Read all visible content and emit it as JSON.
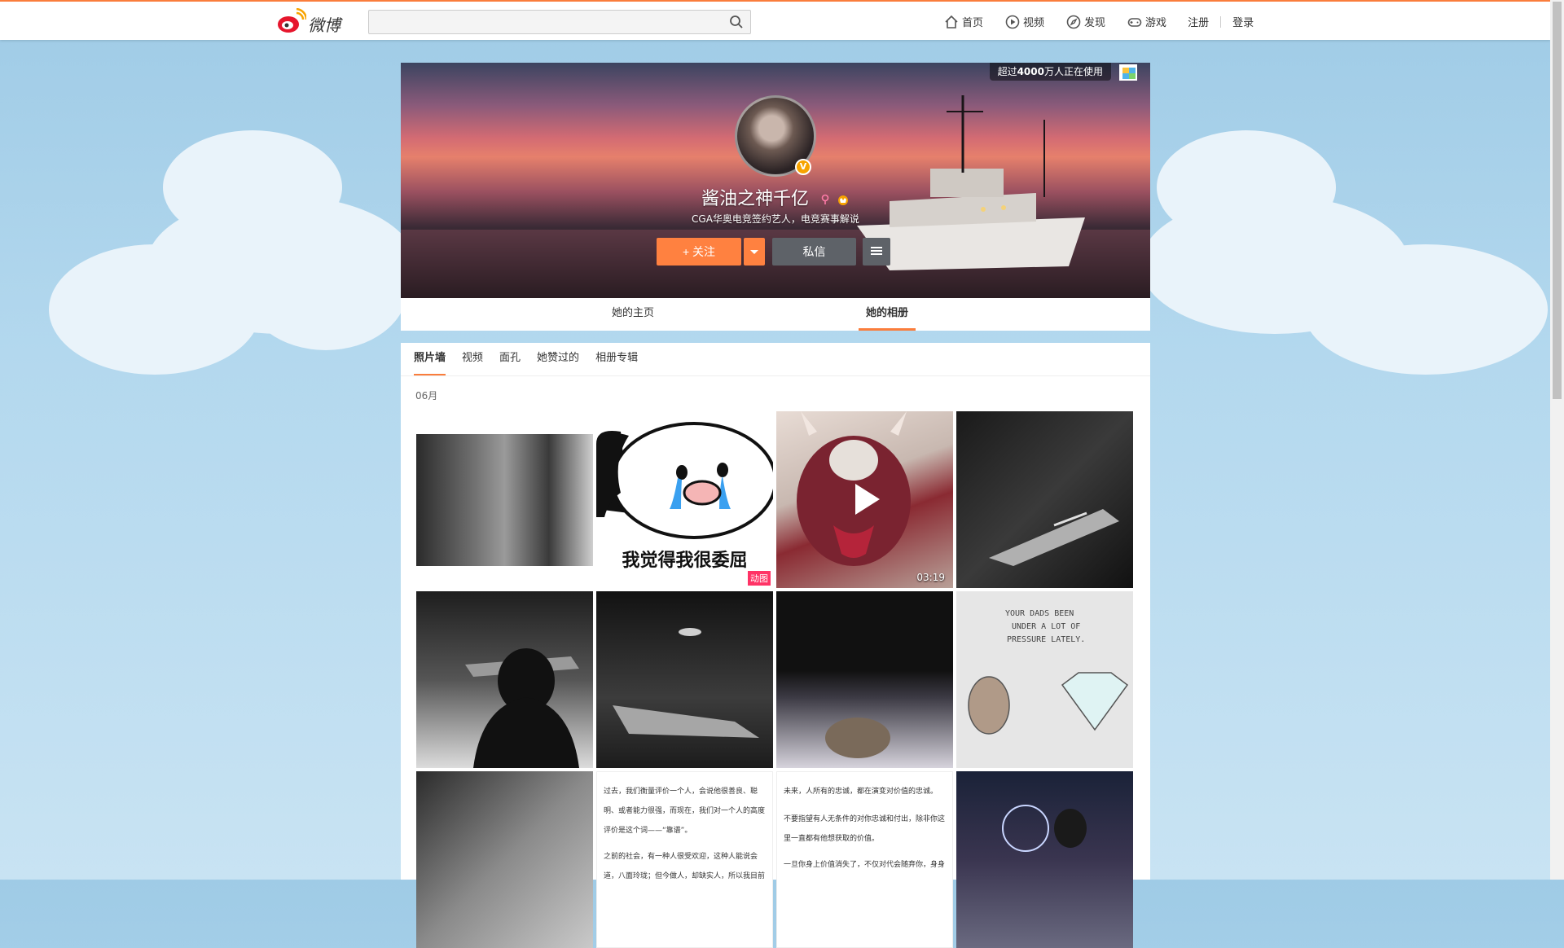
{
  "topbar": {
    "logo_text": "微博",
    "search_placeholder": "",
    "nav": [
      {
        "label": "首页",
        "icon": "home-icon"
      },
      {
        "label": "视频",
        "icon": "video-icon"
      },
      {
        "label": "发现",
        "icon": "discover-icon"
      },
      {
        "label": "游戏",
        "icon": "game-icon"
      }
    ],
    "register": "注册",
    "login": "登录"
  },
  "banner": {
    "using_prefix": "超过",
    "using_count": "4000",
    "using_suffix": "万人正在使用",
    "name": "酱油之神千亿",
    "desc": "CGA华奥电竞签约艺人，电竞赛事解说",
    "follow_label": "+ 关注",
    "message_label": "私信"
  },
  "profile_tabs": [
    {
      "label": "她的主页",
      "active": false
    },
    {
      "label": "她的相册",
      "active": true
    }
  ],
  "album": {
    "sub_tabs": [
      {
        "label": "照片墙",
        "active": true
      },
      {
        "label": "视频",
        "active": false
      },
      {
        "label": "面孔",
        "active": false
      },
      {
        "label": "她赞过的",
        "active": false
      },
      {
        "label": "相册专辑",
        "active": false
      }
    ],
    "month": "06月",
    "meme_text": "我觉得我很委屈",
    "gif_badge": "动图",
    "video_duration": "03:19",
    "cartoon_text_1": "YOUR DADS BEEN",
    "cartoon_text_2": "UNDER A LOT OF",
    "cartoon_text_3": "PRESSURE LATELY.",
    "text_card_1": [
      "过去，我们衡量评价一个人，会说他很善良、聪",
      "明、或者能力很强，而现在，我们对一个人的高度",
      "评价是这个词——“靠谱”。",
      "",
      "之前的社会，有一种人很受欢迎，这种人能说会",
      "道，八面玲珑；但今做人，却缺实人，所以我目前"
    ],
    "text_card_2": [
      "未来，人所有的忠诚，都在演变对价值的忠诚。",
      "不要指望有人无条件的对你忠诚和付出，除非你这",
      "里一直都有他想获取的价值。",
      "",
      "一旦你身上价值消失了，不仅对代会随弃你，身身"
    ]
  }
}
